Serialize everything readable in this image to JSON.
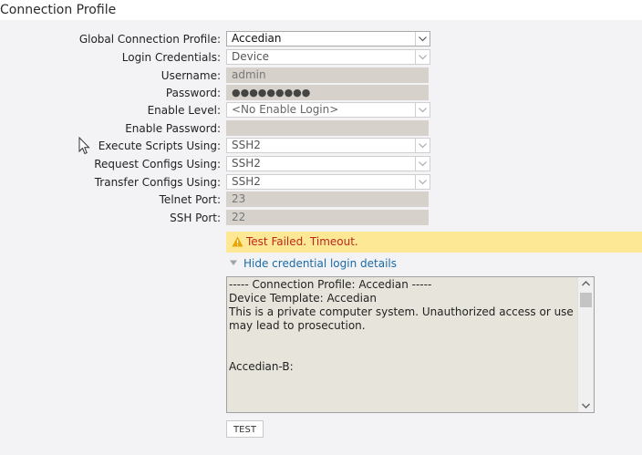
{
  "page": {
    "title": "Connection Profile"
  },
  "form": {
    "global_profile": {
      "label": "Global Connection Profile:",
      "value": "Accedian"
    },
    "login_credentials": {
      "label": "Login Credentials:",
      "value": "Device"
    },
    "username": {
      "label": "Username:",
      "value": "admin"
    },
    "password": {
      "label": "Password:",
      "value": "●●●●●●●●●"
    },
    "enable_level": {
      "label": "Enable Level:",
      "value": "<No Enable Login>"
    },
    "enable_password": {
      "label": "Enable Password:",
      "value": ""
    },
    "execute_scripts": {
      "label": "Execute Scripts Using:",
      "value": "SSH2"
    },
    "request_configs": {
      "label": "Request Configs Using:",
      "value": "SSH2"
    },
    "transfer_configs": {
      "label": "Transfer Configs Using:",
      "value": "SSH2"
    },
    "telnet_port": {
      "label": "Telnet Port:",
      "value": "23"
    },
    "ssh_port": {
      "label": "SSH Port:",
      "value": "22"
    }
  },
  "alert": {
    "message": "Test Failed. Timeout.",
    "icon": "warning-icon"
  },
  "details_toggle": {
    "label": "Hide credential login details",
    "icon": "caret-down-icon"
  },
  "console": {
    "text": "----- Connection Profile: Accedian -----\nDevice Template: Accedian\nThis is a private computer system. Unauthorized access or use may lead to prosecution.\n\n\nAccedian-B:"
  },
  "actions": {
    "test_label": "TEST"
  },
  "colors": {
    "alert_bg": "#fde895",
    "alert_text": "#c0281b",
    "link": "#1a6aa6",
    "readonly_field": "#d6d2cb",
    "console_bg": "#e7e4dc"
  }
}
